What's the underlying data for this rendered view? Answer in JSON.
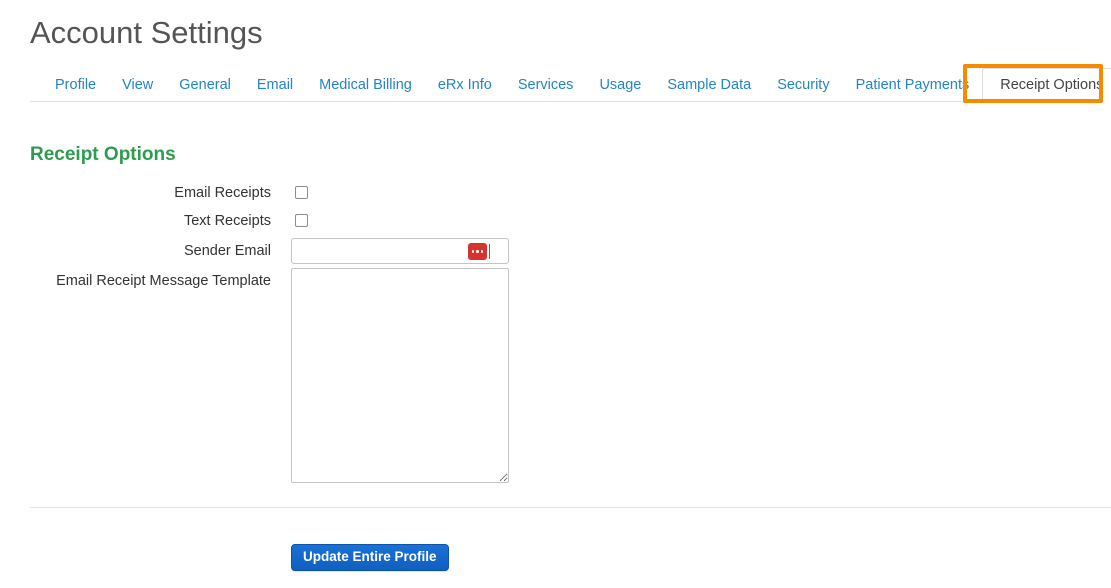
{
  "header": {
    "title": "Account Settings"
  },
  "tabs": [
    {
      "label": "Profile",
      "active": false
    },
    {
      "label": "View",
      "active": false
    },
    {
      "label": "General",
      "active": false
    },
    {
      "label": "Email",
      "active": false
    },
    {
      "label": "Medical Billing",
      "active": false
    },
    {
      "label": "eRx Info",
      "active": false
    },
    {
      "label": "Services",
      "active": false
    },
    {
      "label": "Usage",
      "active": false
    },
    {
      "label": "Sample Data",
      "active": false
    },
    {
      "label": "Security",
      "active": false
    },
    {
      "label": "Patient Payments",
      "active": false
    },
    {
      "label": "Receipt Options",
      "active": true
    }
  ],
  "section": {
    "heading": "Receipt Options"
  },
  "form": {
    "email_receipts": {
      "label": "Email Receipts",
      "checked": false
    },
    "text_receipts": {
      "label": "Text Receipts",
      "checked": false
    },
    "sender_email": {
      "label": "Sender Email",
      "value": "",
      "placeholder": "",
      "autofill_icon": "three-dots-icon"
    },
    "email_receipt_message_template": {
      "label": "Email Receipt Message Template",
      "value": "",
      "placeholder": ""
    }
  },
  "footer": {
    "submit_label": "Update Entire Profile"
  },
  "colors": {
    "tab_link": "#2285c8",
    "section_heading_green": "#2e9b4f",
    "highlight_orange": "#f58b00",
    "submit_blue": "#1267c9",
    "autofill_red": "#d6332e",
    "title_gray": "#555555"
  }
}
